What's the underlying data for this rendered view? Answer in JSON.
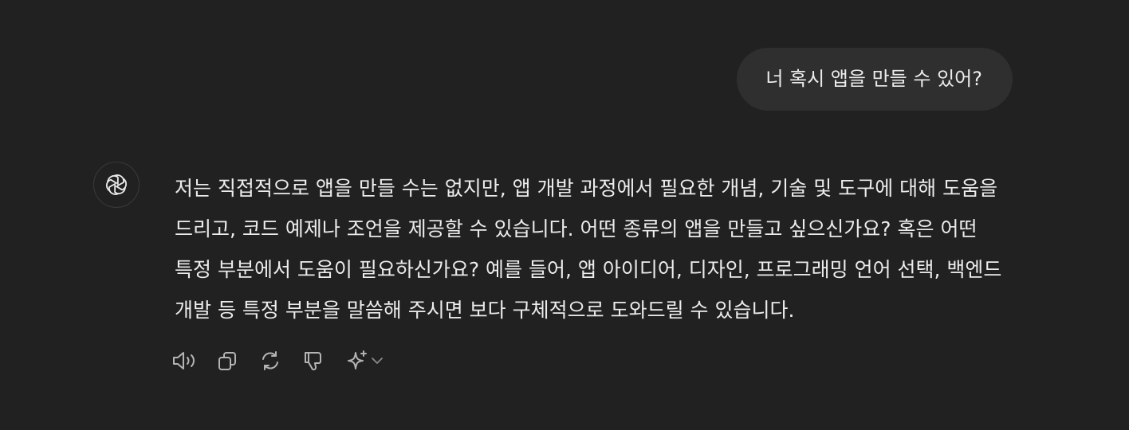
{
  "conversation": {
    "user_message": "너 혹시 앱을 만들 수 있어?",
    "assistant_message": "저는 직접적으로 앱을 만들 수는 없지만, 앱 개발 과정에서 필요한 개념, 기술 및 도구에 대해 도움을 드리고, 코드 예제나 조언을 제공할 수 있습니다. 어떤 종류의 앱을 만들고 싶으신가요? 혹은 어떤 특정 부분에서 도움이 필요하신가요? 예를 들어, 앱 아이디어, 디자인, 프로그래밍 언어 선택, 백엔드 개발 등 특정 부분을 말씀해 주시면 보다 구체적으로 도와드릴 수 있습니다."
  },
  "assistant": {
    "avatar_icon": "openai-logo-icon"
  },
  "actions": [
    {
      "icon": "speaker-icon"
    },
    {
      "icon": "copy-icon"
    },
    {
      "icon": "regenerate-icon"
    },
    {
      "icon": "thumbs-down-icon"
    },
    {
      "icon": "sparkle-icon"
    },
    {
      "icon": "chevron-down-icon"
    }
  ],
  "colors": {
    "background": "#212121",
    "user_bubble": "#2f2f2f",
    "text": "#ececec",
    "icon": "#b4b4b4"
  }
}
